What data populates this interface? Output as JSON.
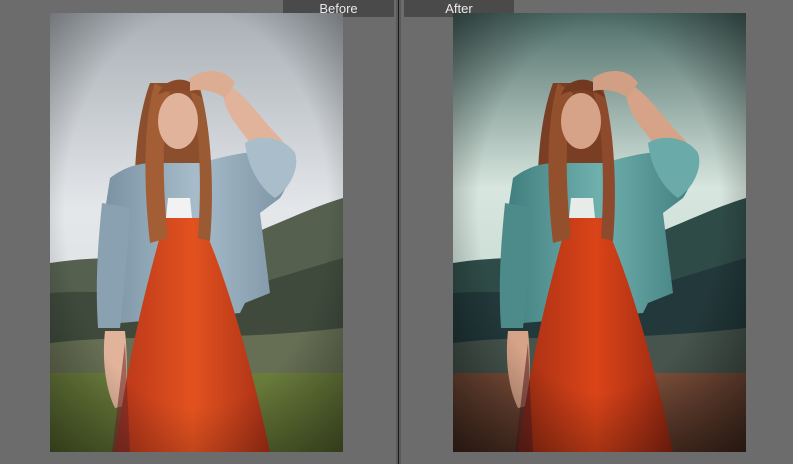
{
  "labels": {
    "before": "Before",
    "after": "After"
  },
  "colors": {
    "workspace": "#6f6f6f",
    "tab_background": "#4a4a4a",
    "tab_text": "#e8e8e8",
    "divider": "#1b1b1b"
  },
  "photos": {
    "before": {
      "sky_top": "#c9ccd0",
      "sky_bottom": "#e6e9ec",
      "hills": "#4f5a4e",
      "grass": "#6f8140",
      "dress": "#d9451d",
      "jacket": "#8fa6b5",
      "hair": "#9a5a34",
      "skin": "#e0b39a"
    },
    "after": {
      "sky_top": "#6f8f89",
      "sky_bottom": "#d8e6df",
      "hills": "#2c4643",
      "grass": "#7a4a36",
      "dress": "#d13b18",
      "jacket": "#5f9c9c",
      "hair": "#8e4a2c",
      "skin": "#d7a388"
    }
  }
}
